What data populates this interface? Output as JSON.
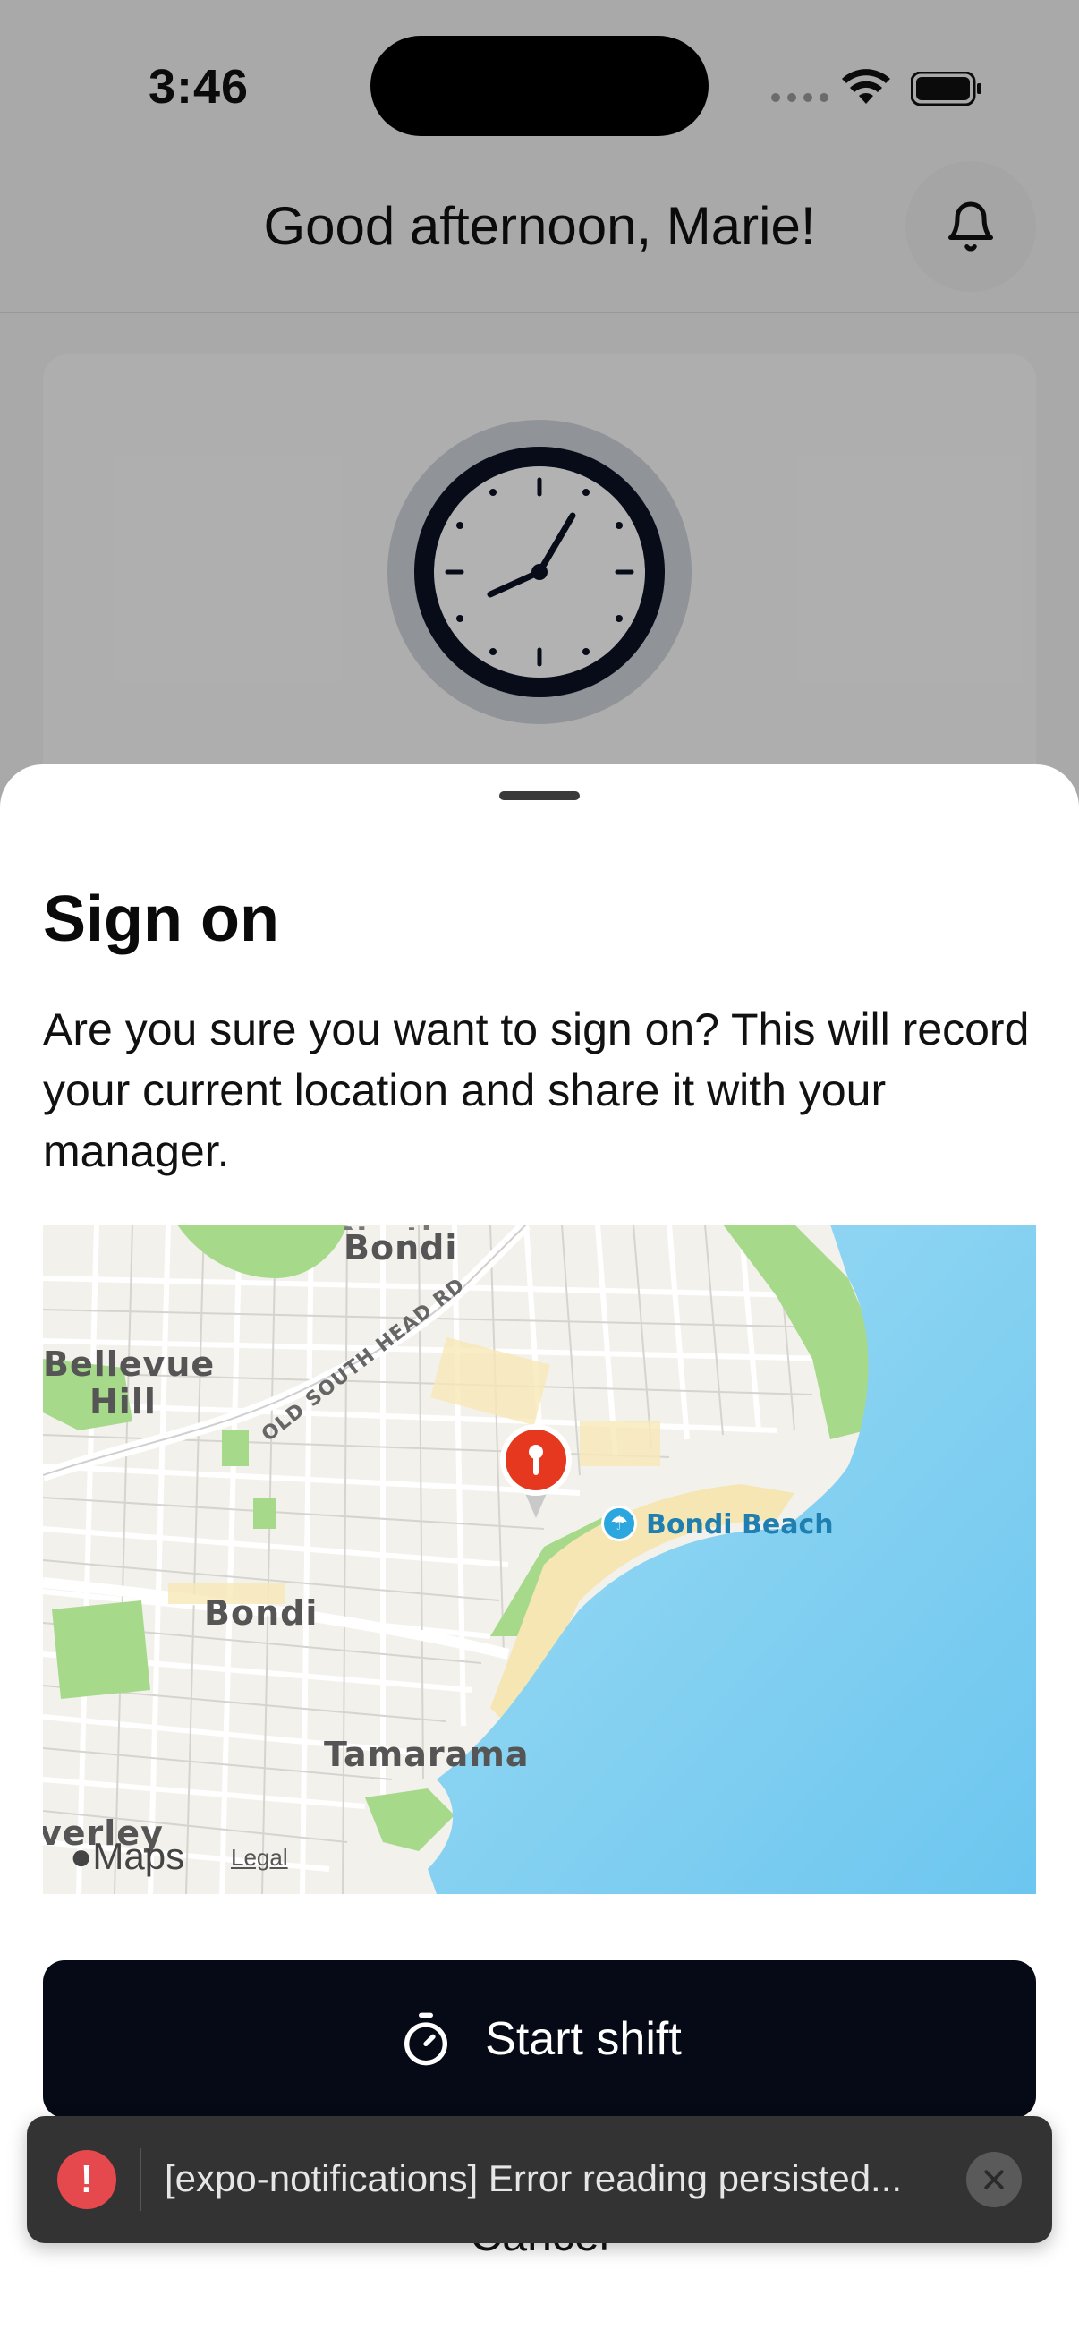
{
  "status_bar": {
    "time": "3:46",
    "icons": [
      "cellular-signal-icon",
      "wifi-icon",
      "battery-icon"
    ]
  },
  "header": {
    "greeting": "Good afternoon, Marie!",
    "icon": "bell-icon"
  },
  "clock_card": {
    "icon": "clock-icon"
  },
  "sheet": {
    "title": "Sign on",
    "description": "Are you sure you want to sign on? This will record your current location and share it with your manager.",
    "map": {
      "labels": {
        "north_bondi": "North Bondi",
        "bellevue_hill": "Bellevue Hill",
        "old_south_head_rd": "OLD SOUTH HEAD RD",
        "bondi_beach": "Bondi Beach",
        "bondi": "Bondi",
        "tamarama": "Tamarama",
        "bronte_edge": "verley"
      },
      "attribution": "Maps",
      "legal": "Legal",
      "pin_icon": "location-pin-icon"
    },
    "start_button": {
      "label": "Start shift",
      "icon": "stopwatch-icon"
    },
    "cancel_label": "Cancel"
  },
  "toast": {
    "message": "[expo-notifications] Error reading persisted...",
    "icon": "error-icon",
    "close_icon": "close-icon"
  },
  "colors": {
    "primary_button": "#060a16",
    "toast_bg": "#333333",
    "error": "#e5484d",
    "water": "#7fcff0",
    "park": "#a6d98a"
  }
}
